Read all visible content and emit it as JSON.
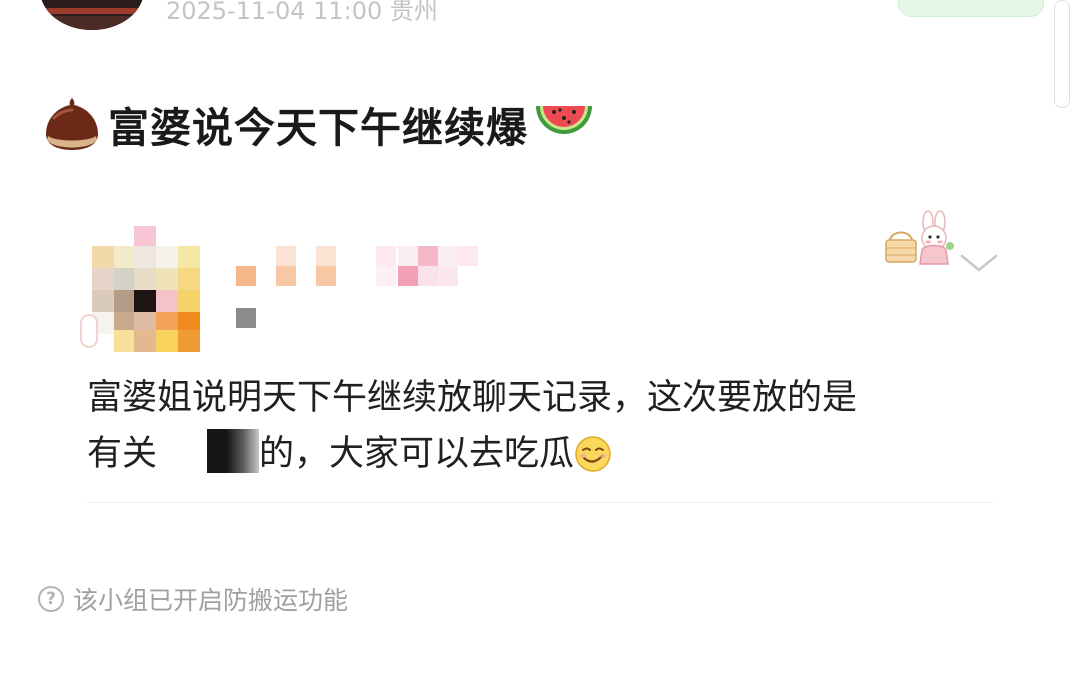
{
  "post": {
    "meta": "2025-11-04 11:00  贵州",
    "title": "富婆说今天下午继续爆",
    "title_emoji_left": "chestnut-icon",
    "title_emoji_right": "watermelon-icon"
  },
  "comment": {
    "text_line1": "富婆姐说明天下午继续放聊天记录，这次要放的是",
    "text_line2_before": "有关",
    "text_line2_after": "的，大家可以去吃瓜",
    "emoji": "smirk-face-icon"
  },
  "footer": {
    "anti_move_notice": "该小组已开启防搬运功能",
    "icon": "question-circle-icon"
  },
  "colors": {
    "accent_green_bg": "#e6f7e8",
    "meta_gray": "#c4c4c4",
    "notice_gray": "#a0a0a0"
  }
}
